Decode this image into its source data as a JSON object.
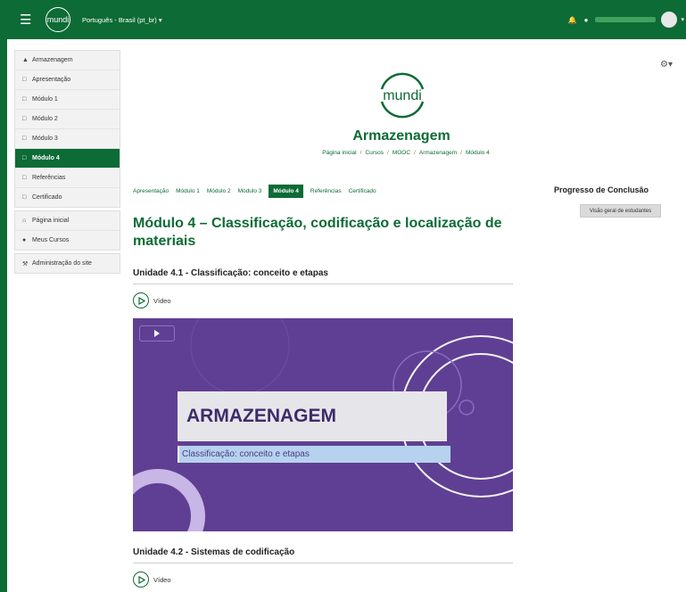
{
  "navbar": {
    "brand": "mundi",
    "language": "Português - Brasil (pt_br)"
  },
  "sidebar": {
    "course_items": [
      {
        "label": "Armazenagem",
        "icon": "graduation-cap-icon"
      },
      {
        "label": "Apresentação",
        "icon": "folder-icon"
      },
      {
        "label": "Módulo 1",
        "icon": "folder-icon"
      },
      {
        "label": "Módulo 2",
        "icon": "folder-icon"
      },
      {
        "label": "Módulo 3",
        "icon": "folder-icon"
      },
      {
        "label": "Módulo 4",
        "icon": "folder-icon"
      },
      {
        "label": "Referências",
        "icon": "folder-icon"
      },
      {
        "label": "Certificado",
        "icon": "folder-icon"
      }
    ],
    "site_items": [
      {
        "label": "Página inicial",
        "icon": "home-icon"
      },
      {
        "label": "Meus Cursos",
        "icon": "users-icon"
      }
    ],
    "admin_items": [
      {
        "label": "Administração do site",
        "icon": "wrench-icon"
      }
    ]
  },
  "header": {
    "logo_text": "mundi",
    "course_title": "Armazenagem",
    "breadcrumb": [
      "Página inicial",
      "Cursos",
      "MOOC",
      "Armazenagem",
      "Módulo 4"
    ]
  },
  "tabs": [
    "Apresentação",
    "Módulo 1",
    "Módulo 2",
    "Módulo 3",
    "Módulo 4",
    "Referências",
    "Certificado"
  ],
  "active_tab": "Módulo 4",
  "progress": {
    "title": "Progresso de Conclusão",
    "button": "Visão geral de estudantes"
  },
  "module_title": "Módulo 4 – Classificação, codificação e localização de materiais",
  "units": [
    {
      "title": "Unidade 4.1 - Classificação: conceito e etapas",
      "video_label": "Vídeo"
    },
    {
      "title": "Unidade 4.2 - Sistemas de codificação",
      "video_label": "Vídeo"
    }
  ],
  "video": {
    "title": "ARMAZENAGEM",
    "subtitle": "Classificação: conceito e etapas"
  },
  "colors": {
    "brand_green": "#0d6b35",
    "video_purple": "#5f3f93"
  }
}
